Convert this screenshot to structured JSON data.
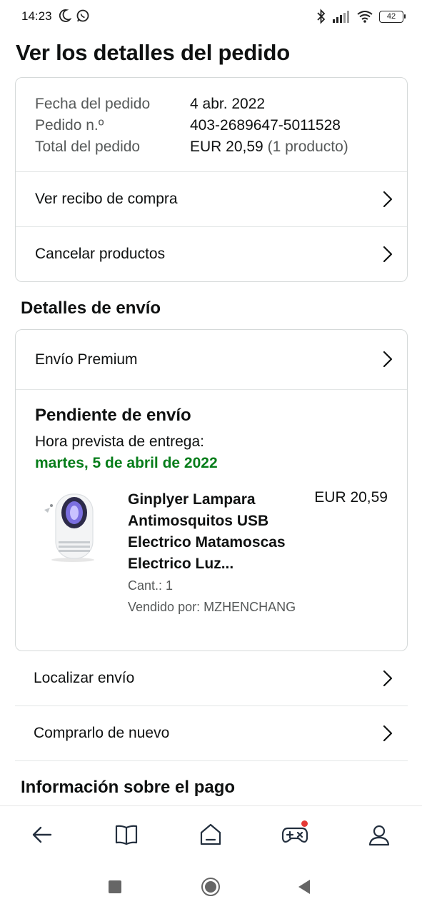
{
  "status_bar": {
    "time": "14:23",
    "battery": "42",
    "icons": [
      "moon-icon",
      "whatsapp-icon",
      "bluetooth-icon",
      "signal-icon",
      "wifi-icon",
      "battery-icon"
    ]
  },
  "page_title": "Ver los detalles del pedido",
  "order_summary": {
    "rows": [
      {
        "label": "Fecha del pedido",
        "value": "4 abr. 2022"
      },
      {
        "label": "Pedido n.º",
        "value": "403-2689647-5011528"
      },
      {
        "label": "Total del pedido",
        "value": "EUR 20,59",
        "extra": "(1 producto)"
      }
    ],
    "links": [
      "Ver recibo de compra",
      "Cancelar productos"
    ]
  },
  "shipping": {
    "section_title": "Detalles de envío",
    "method": "Envío Premium",
    "status_title": "Pendiente de envío",
    "delivery_label": "Hora prevista de entrega:",
    "delivery_date": "martes, 5 de abril de 2022",
    "product": {
      "name": "Ginplyer Lampara Antimosquitos USB Electrico Matamoscas Electrico Luz...",
      "price": "EUR 20,59",
      "quantity": "Cant.: 1",
      "seller": "Vendido por: MZHENCHANG"
    },
    "actions": [
      "Localizar envío",
      "Comprarlo de nuevo"
    ]
  },
  "payment": {
    "section_title": "Información sobre el pago"
  },
  "bottom_nav": [
    "back-icon",
    "book-icon",
    "home-icon",
    "gamepad-icon",
    "account-icon"
  ],
  "colors": {
    "delivery_green": "#067d1a",
    "text_primary": "#0f1111",
    "text_secondary": "#565959",
    "border": "#d5d9d9",
    "notification_red": "#e53935"
  }
}
